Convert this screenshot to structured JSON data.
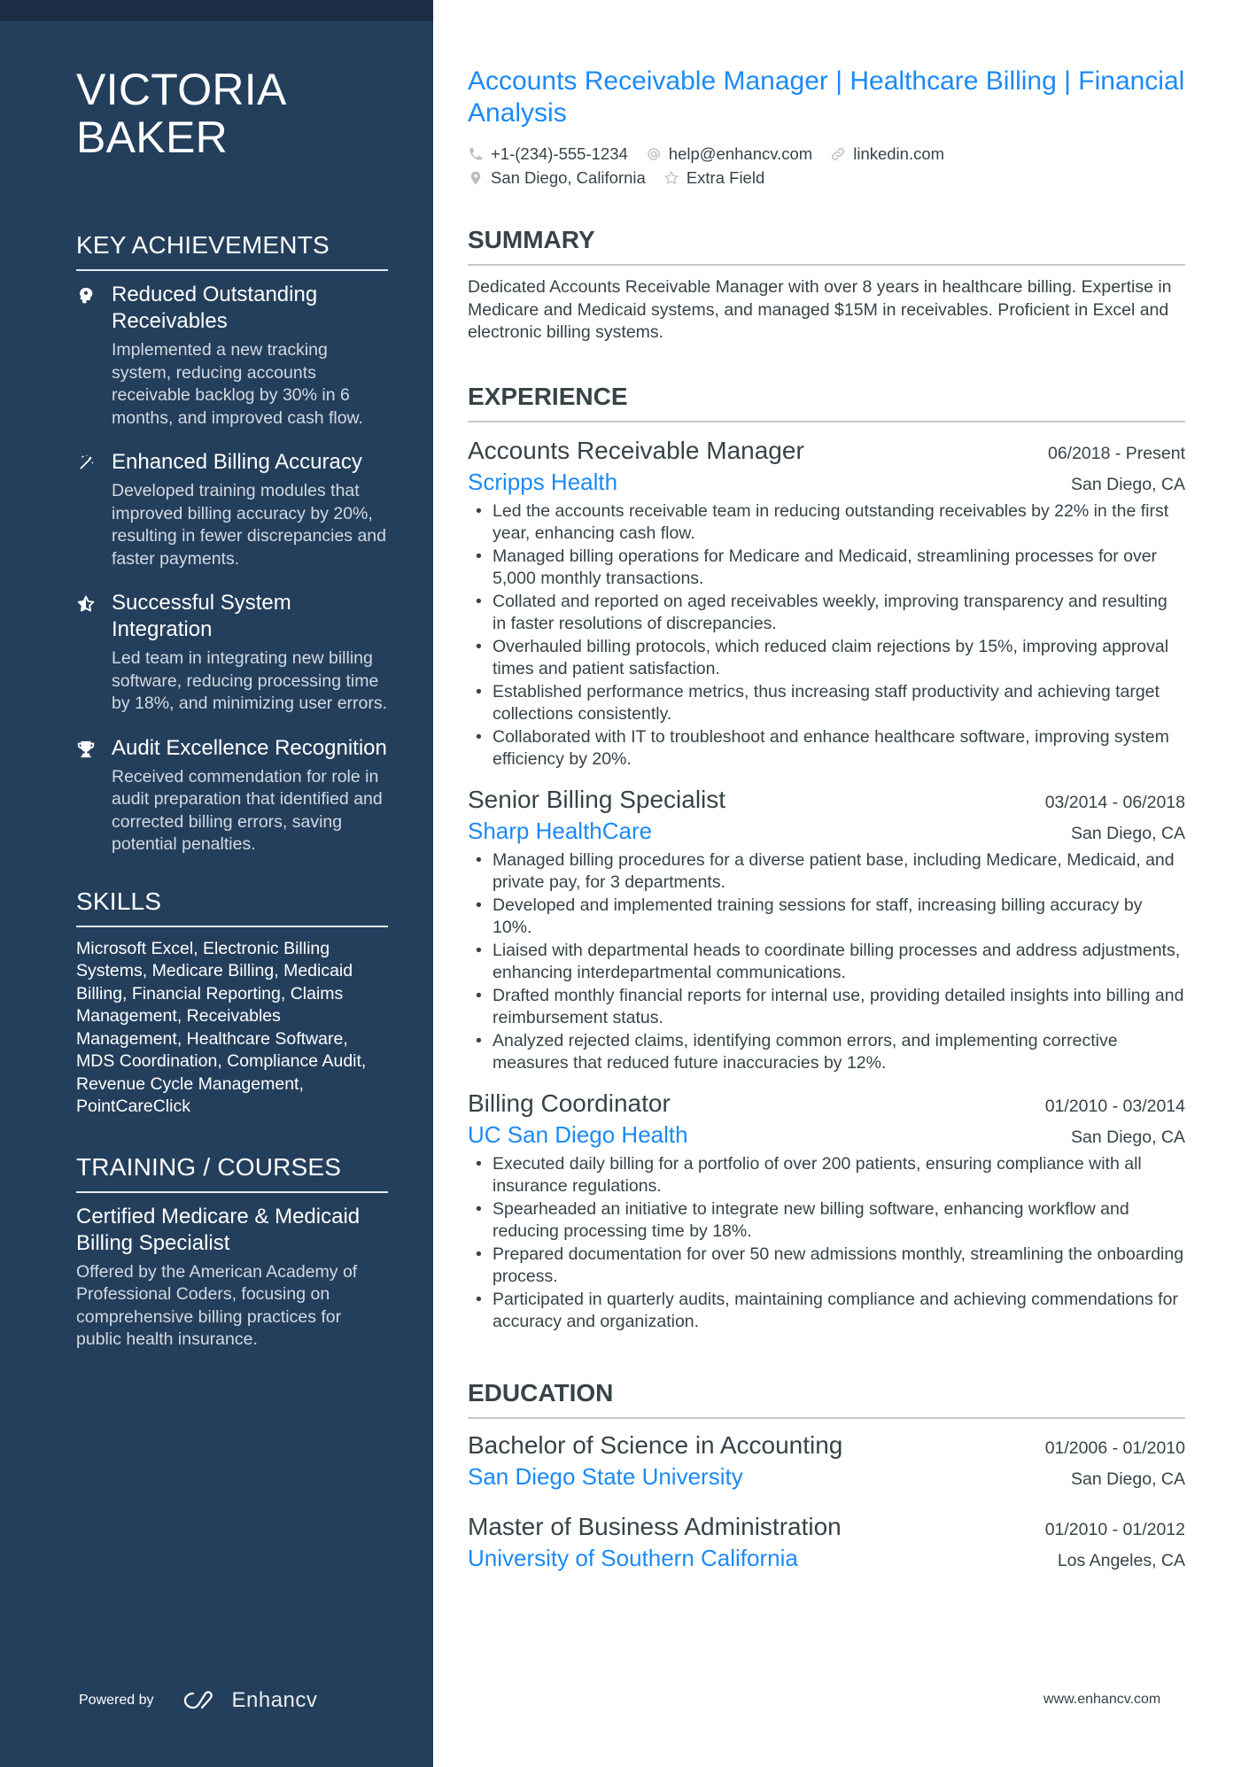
{
  "sidebar": {
    "name_first": "VICTORIA",
    "name_last": "BAKER",
    "achievements_heading": "KEY ACHIEVEMENTS",
    "achievements": [
      {
        "icon": "brain-head-icon",
        "title": "Reduced Outstanding Receivables",
        "description": "Implemented a new tracking system, reducing accounts receivable backlog by 30% in 6 months, and improved cash flow."
      },
      {
        "icon": "magic-wand-icon",
        "title": "Enhanced Billing Accuracy",
        "description": "Developed training modules that improved billing accuracy by 20%, resulting in fewer discrepancies and faster payments."
      },
      {
        "icon": "star-half-icon",
        "title": "Successful System Integration",
        "description": "Led team in integrating new billing software, reducing processing time by 18%, and minimizing user errors."
      },
      {
        "icon": "trophy-icon",
        "title": "Audit Excellence Recognition",
        "description": "Received commendation for role in audit preparation that identified and corrected billing errors, saving potential penalties."
      }
    ],
    "skills_heading": "SKILLS",
    "skills_text": "Microsoft Excel, Electronic Billing Systems, Medicare Billing, Medicaid Billing, Financial Reporting, Claims Management, Receivables Management, Healthcare Software, MDS Coordination, Compliance Audit, Revenue Cycle Management, PointCareClick",
    "training_heading": "TRAINING / COURSES",
    "courses": [
      {
        "title": "Certified Medicare & Medicaid Billing Specialist",
        "description": "Offered by the American Academy of Professional Coders, focusing on comprehensive billing practices for public health insurance."
      }
    ],
    "powered_by": "Powered by",
    "brand": "Enhancv"
  },
  "header": {
    "headline": "Accounts Receivable Manager | Healthcare Billing | Financial Analysis",
    "contacts": {
      "phone": "+1-(234)-555-1234",
      "email": "help@enhancv.com",
      "link": "linkedin.com",
      "location": "San Diego, California",
      "extra": "Extra Field"
    }
  },
  "summary": {
    "heading": "SUMMARY",
    "text": "Dedicated Accounts Receivable Manager with over 8 years in healthcare billing. Expertise in Medicare and Medicaid systems, and managed $15M in receivables. Proficient in Excel and electronic billing systems."
  },
  "experience": {
    "heading": "EXPERIENCE",
    "jobs": [
      {
        "title": "Accounts Receivable Manager",
        "dates": "06/2018 - Present",
        "company": "Scripps Health",
        "location": "San Diego, CA",
        "bullets": [
          "Led the accounts receivable team in reducing outstanding receivables by 22% in the first year, enhancing cash flow.",
          "Managed billing operations for Medicare and Medicaid, streamlining processes for over 5,000 monthly transactions.",
          "Collated and reported on aged receivables weekly, improving transparency and resulting in faster resolutions of discrepancies.",
          "Overhauled billing protocols, which reduced claim rejections by 15%, improving approval times and patient satisfaction.",
          "Established performance metrics, thus increasing staff productivity and achieving target collections consistently.",
          "Collaborated with IT to troubleshoot and enhance healthcare software, improving system efficiency by 20%."
        ]
      },
      {
        "title": "Senior Billing Specialist",
        "dates": "03/2014 - 06/2018",
        "company": "Sharp HealthCare",
        "location": "San Diego, CA",
        "bullets": [
          "Managed billing procedures for a diverse patient base, including Medicare, Medicaid, and private pay, for 3 departments.",
          "Developed and implemented training sessions for staff, increasing billing accuracy by 10%.",
          "Liaised with departmental heads to coordinate billing processes and address adjustments, enhancing interdepartmental communications.",
          "Drafted monthly financial reports for internal use, providing detailed insights into billing and reimbursement status.",
          "Analyzed rejected claims, identifying common errors, and implementing corrective measures that reduced future inaccuracies by 12%."
        ]
      },
      {
        "title": "Billing Coordinator",
        "dates": "01/2010 - 03/2014",
        "company": "UC San Diego Health",
        "location": "San Diego, CA",
        "bullets": [
          "Executed daily billing for a portfolio of over 200 patients, ensuring compliance with all insurance regulations.",
          "Spearheaded an initiative to integrate new billing software, enhancing workflow and reducing processing time by 18%.",
          "Prepared documentation for over 50 new admissions monthly, streamlining the onboarding process.",
          "Participated in quarterly audits, maintaining compliance and achieving commendations for accuracy and organization."
        ]
      }
    ]
  },
  "education": {
    "heading": "EDUCATION",
    "entries": [
      {
        "degree": "Bachelor of Science in Accounting",
        "dates": "01/2006 - 01/2010",
        "school": "San Diego State University",
        "location": "San Diego, CA"
      },
      {
        "degree": "Master of Business Administration",
        "dates": "01/2010 - 01/2012",
        "school": "University of Southern California",
        "location": "Los Angeles, CA"
      }
    ]
  },
  "footer": {
    "website": "www.enhancv.com"
  },
  "colors": {
    "sidebar_bg": "#243f5c",
    "sidebar_top": "#1b2d44",
    "accent": "#1c8af5",
    "text": "#384347"
  }
}
